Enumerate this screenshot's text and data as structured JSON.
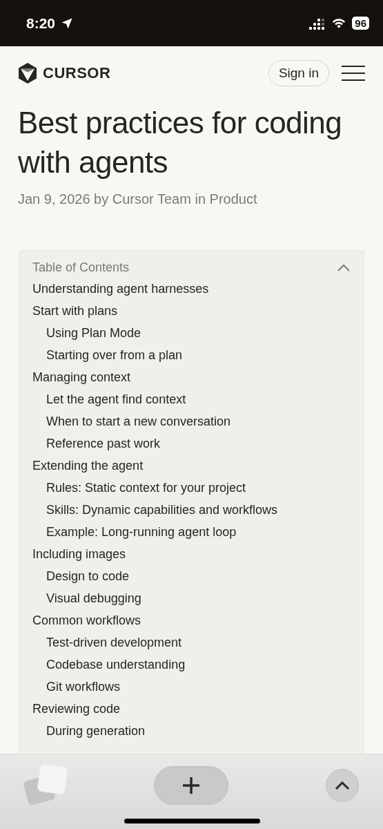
{
  "status_bar": {
    "time": "8:20",
    "battery": "96"
  },
  "header": {
    "logo": "CURSOR",
    "sign_in": "Sign in"
  },
  "article": {
    "title": "Best practices for coding with agents",
    "meta": "Jan 9, 2026 by Cursor Team in Product"
  },
  "toc": {
    "title": "Table of Contents",
    "expanded": true,
    "items": [
      {
        "label": "Understanding agent harnesses"
      },
      {
        "label": "Start with plans",
        "children": [
          {
            "label": "Using Plan Mode"
          },
          {
            "label": "Starting over from a plan"
          }
        ]
      },
      {
        "label": "Managing context",
        "children": [
          {
            "label": "Let the agent find context"
          },
          {
            "label": "When to start a new conversation"
          },
          {
            "label": "Reference past work"
          }
        ]
      },
      {
        "label": "Extending the agent",
        "children": [
          {
            "label": "Rules: Static context for your project"
          },
          {
            "label": "Skills: Dynamic capabilities and workflows"
          },
          {
            "label": "Example: Long-running agent loop"
          }
        ]
      },
      {
        "label": "Including images",
        "children": [
          {
            "label": "Design to code"
          },
          {
            "label": "Visual debugging"
          }
        ]
      },
      {
        "label": "Common workflows",
        "children": [
          {
            "label": "Test-driven development"
          },
          {
            "label": "Codebase understanding"
          },
          {
            "label": "Git workflows"
          }
        ]
      },
      {
        "label": "Reviewing code",
        "children": [
          {
            "label": "During generation"
          }
        ]
      }
    ]
  }
}
